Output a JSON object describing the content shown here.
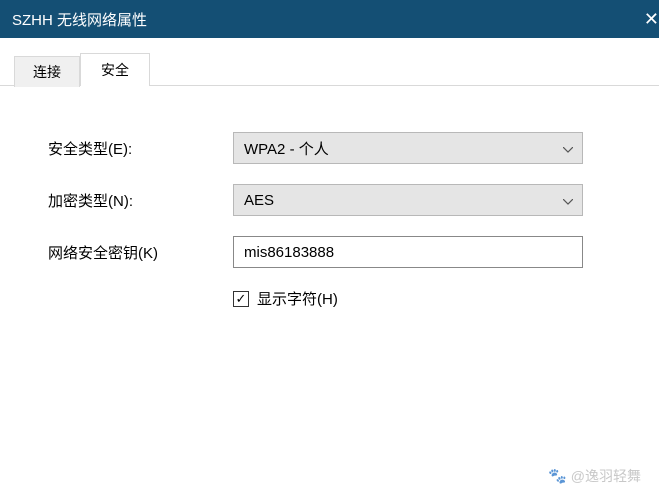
{
  "titlebar": {
    "title": "SZHH 无线网络属性",
    "bg_color": "#144f74"
  },
  "tabs": {
    "connection": "连接",
    "security": "安全"
  },
  "form": {
    "security_type": {
      "label": "安全类型(E):",
      "value": "WPA2 - 个人"
    },
    "encryption_type": {
      "label": "加密类型(N):",
      "value": "AES"
    },
    "network_key": {
      "label": "网络安全密钥(K)",
      "value": "mis86183888"
    },
    "show_chars": {
      "label": "显示字符(H)",
      "checked": true
    }
  },
  "watermark": {
    "text": "@逸羽轻舞"
  }
}
